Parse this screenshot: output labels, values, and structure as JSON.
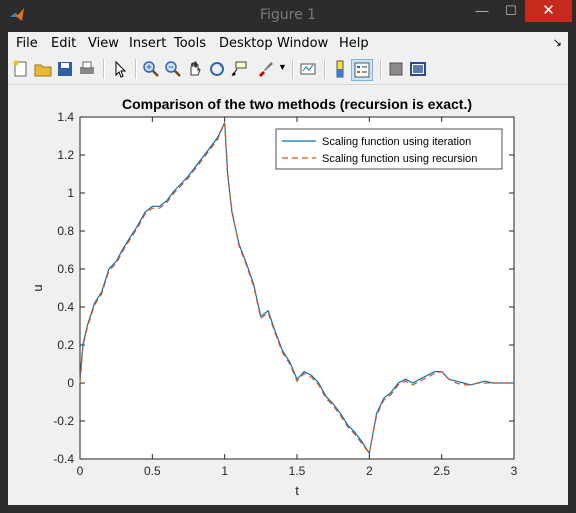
{
  "window": {
    "title": "Figure 1",
    "minimize_glyph": "—",
    "maximize_glyph": "☐",
    "close_glyph": "✕",
    "app_icon": "matlab-icon"
  },
  "menu": {
    "items": [
      "File",
      "Edit",
      "View",
      "Insert",
      "Tools",
      "Desktop",
      "Window",
      "Help"
    ],
    "overflow_glyph": "↘"
  },
  "toolbar": {
    "icons": [
      "new-figure-icon",
      "open-file-icon",
      "save-icon",
      "print-icon",
      "pointer-icon",
      "zoom-in-icon",
      "zoom-out-icon",
      "pan-icon",
      "rotate-icon",
      "data-cursor-icon",
      "brush-icon",
      "link-plot-icon",
      "colorbar-icon",
      "legend-icon",
      "hide-plot-tools-icon",
      "show-plot-tools-icon"
    ]
  },
  "colors": {
    "series1": "#0072bd",
    "series2": "#d95319",
    "close_button": "#c42b1c"
  },
  "chart_data": {
    "type": "line",
    "title": "Comparison of the two methods (recursion is exact.)",
    "xlabel": "t",
    "ylabel": "u",
    "xlim": [
      0,
      3
    ],
    "ylim": [
      -0.4,
      1.4
    ],
    "xticks": [
      "0",
      "0.5",
      "1",
      "1.5",
      "2",
      "2.5",
      "3"
    ],
    "yticks": [
      "-0.4",
      "-0.2",
      "0",
      "0.2",
      "0.4",
      "0.6",
      "0.8",
      "1",
      "1.2",
      "1.4"
    ],
    "legend_position": "top-right",
    "grid": false,
    "series": [
      {
        "name": "Scaling function using iteration",
        "style": "solid",
        "x": [
          0,
          0.02,
          0.05,
          0.1,
          0.15,
          0.2,
          0.25,
          0.3,
          0.35,
          0.4,
          0.45,
          0.5,
          0.55,
          0.6,
          0.65,
          0.7,
          0.75,
          0.8,
          0.85,
          0.9,
          0.95,
          1.0,
          1.02,
          1.05,
          1.1,
          1.15,
          1.2,
          1.25,
          1.3,
          1.35,
          1.4,
          1.45,
          1.5,
          1.55,
          1.6,
          1.65,
          1.7,
          1.75,
          1.8,
          1.85,
          1.9,
          1.95,
          2.0,
          2.05,
          2.1,
          2.15,
          2.2,
          2.25,
          2.3,
          2.35,
          2.4,
          2.45,
          2.5,
          2.55,
          2.6,
          2.65,
          2.7,
          2.75,
          2.8,
          2.85,
          2.9,
          2.95,
          3.0
        ],
        "y": [
          0.02,
          0.2,
          0.3,
          0.42,
          0.48,
          0.6,
          0.64,
          0.71,
          0.77,
          0.83,
          0.9,
          0.93,
          0.93,
          0.96,
          1.01,
          1.05,
          1.09,
          1.14,
          1.19,
          1.24,
          1.29,
          1.37,
          1.1,
          0.9,
          0.73,
          0.63,
          0.52,
          0.35,
          0.38,
          0.27,
          0.17,
          0.11,
          0.02,
          0.06,
          0.04,
          0.0,
          -0.07,
          -0.11,
          -0.16,
          -0.22,
          -0.26,
          -0.31,
          -0.37,
          -0.16,
          -0.08,
          -0.05,
          0.0,
          0.02,
          0.0,
          0.02,
          0.04,
          0.06,
          0.06,
          0.02,
          0.01,
          0.0,
          -0.01,
          0.0,
          0.01,
          0.0,
          0.0,
          0.0,
          0.0
        ]
      },
      {
        "name": "Scaling function using recursion",
        "style": "dashed",
        "x": [
          0,
          0.02,
          0.05,
          0.1,
          0.15,
          0.2,
          0.25,
          0.3,
          0.35,
          0.4,
          0.45,
          0.5,
          0.55,
          0.6,
          0.65,
          0.7,
          0.75,
          0.8,
          0.85,
          0.9,
          0.95,
          1.0,
          1.02,
          1.05,
          1.1,
          1.15,
          1.2,
          1.25,
          1.3,
          1.35,
          1.4,
          1.45,
          1.5,
          1.55,
          1.6,
          1.65,
          1.7,
          1.75,
          1.8,
          1.85,
          1.9,
          1.95,
          2.0,
          2.05,
          2.1,
          2.15,
          2.2,
          2.25,
          2.3,
          2.35,
          2.4,
          2.45,
          2.5,
          2.55,
          2.6,
          2.65,
          2.7,
          2.75,
          2.8,
          2.85,
          2.9,
          2.95,
          3.0
        ],
        "y": [
          0.0,
          0.19,
          0.29,
          0.41,
          0.47,
          0.59,
          0.63,
          0.7,
          0.76,
          0.82,
          0.89,
          0.92,
          0.92,
          0.95,
          1.0,
          1.04,
          1.08,
          1.13,
          1.18,
          1.23,
          1.28,
          1.37,
          1.11,
          0.91,
          0.72,
          0.62,
          0.51,
          0.34,
          0.37,
          0.26,
          0.16,
          0.1,
          0.01,
          0.05,
          0.03,
          -0.01,
          -0.08,
          -0.12,
          -0.17,
          -0.23,
          -0.27,
          -0.32,
          -0.37,
          -0.17,
          -0.09,
          -0.06,
          -0.01,
          0.01,
          -0.01,
          0.01,
          0.03,
          0.05,
          0.06,
          0.02,
          0.0,
          -0.01,
          -0.01,
          0.0,
          0.0,
          0.0,
          0.0,
          0.0,
          0.0
        ]
      }
    ]
  }
}
